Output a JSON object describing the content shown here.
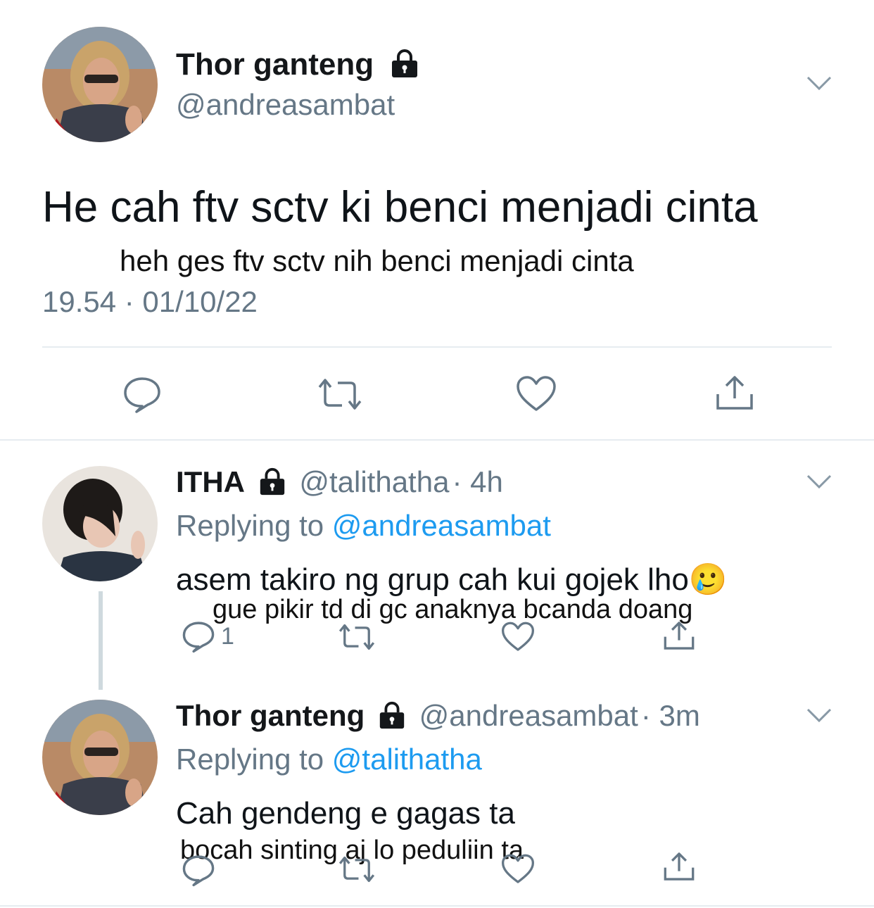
{
  "main_tweet": {
    "name": "Thor ganteng",
    "handle": "@andreasambat",
    "text": "He cah ftv sctv ki benci menjadi cinta",
    "translation": "heh ges ftv sctv nih benci menjadi cinta",
    "timestamp": "19.54 · 01/10/22"
  },
  "replies": [
    {
      "name": "ITHA",
      "handle": "@talithatha",
      "time": "· 4h",
      "replying_prefix": "Replying to",
      "replying_to": "@andreasambat",
      "text": "asem takiro ng grup cah kui gojek lho",
      "emoji": "🥲",
      "translation": "gue pikir td di gc anaknya bcanda doang",
      "reply_count": "1"
    },
    {
      "name": "Thor ganteng",
      "handle": "@andreasambat",
      "time": "· 3m",
      "replying_prefix": "Replying to",
      "replying_to": "@talithatha",
      "text": "Cah gendeng e gagas ta",
      "translation": "bocah sinting aj lo peduliin ta",
      "reply_count": ""
    }
  ],
  "colors": {
    "text": "#14171a",
    "muted": "#657786",
    "link": "#1d9bf0",
    "divider": "#e6ecf0",
    "icon": "#657786"
  },
  "icons": [
    "lock-icon",
    "chevron-down-icon",
    "reply-icon",
    "retweet-icon",
    "like-icon",
    "share-icon"
  ]
}
